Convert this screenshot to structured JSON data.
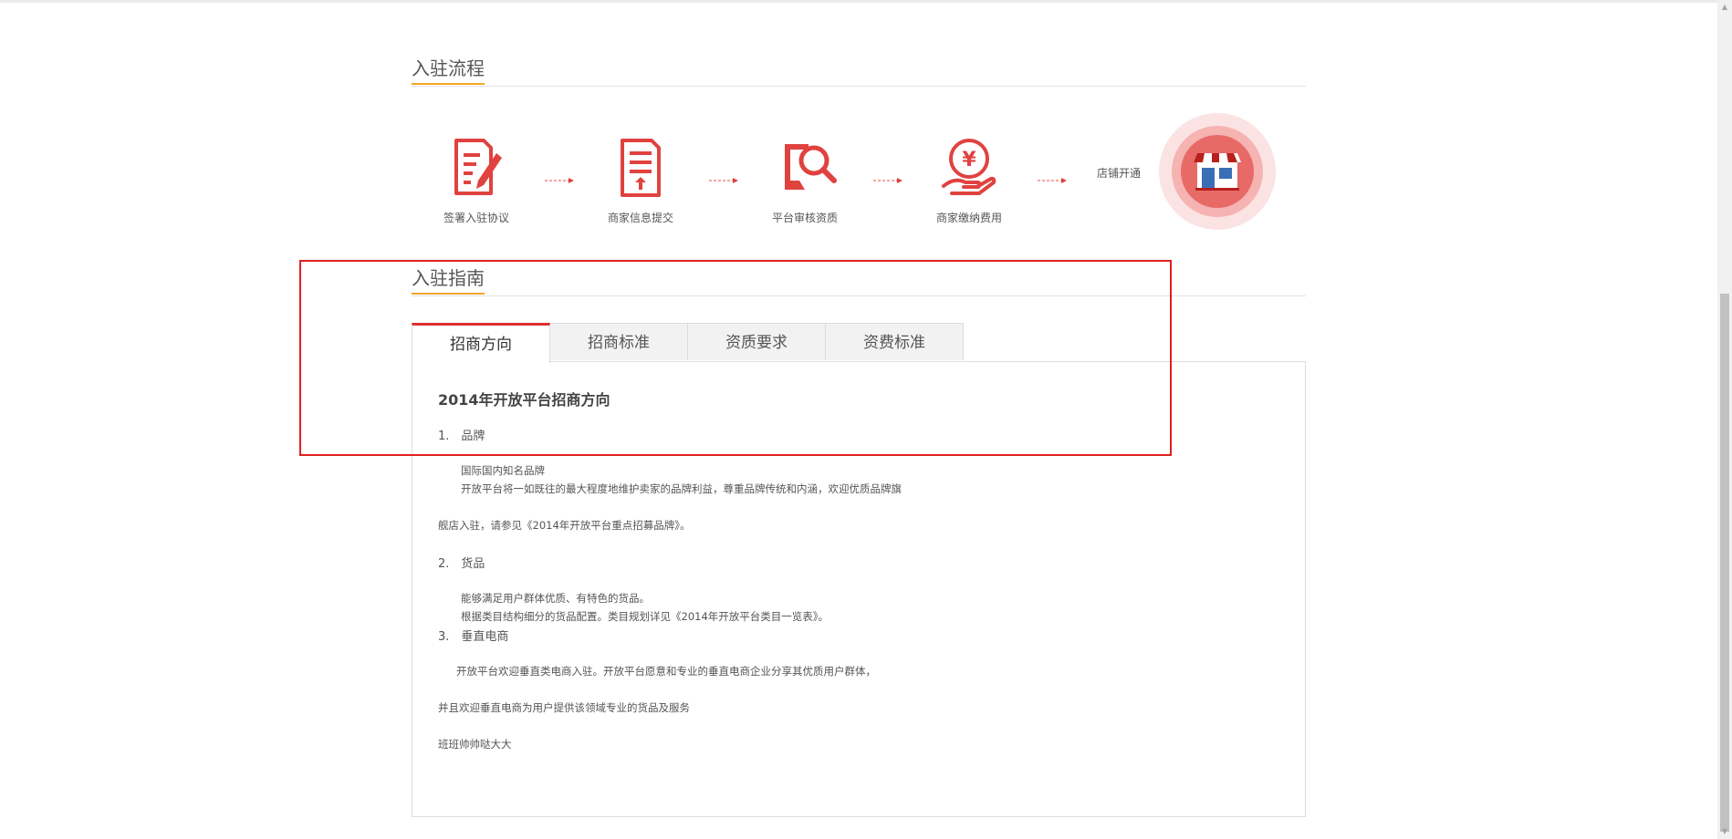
{
  "process": {
    "title": "入驻流程",
    "steps": [
      {
        "label": "签署入驻协议",
        "icon": "sign-contract-icon"
      },
      {
        "label": "商家信息提交",
        "icon": "upload-document-icon"
      },
      {
        "label": "平台审核资质",
        "icon": "review-search-icon"
      },
      {
        "label": "商家缴纳费用",
        "icon": "yuan-payment-icon"
      }
    ],
    "final_label": "店铺开通",
    "final_icon": "shop-store-icon"
  },
  "guide": {
    "title": "入驻指南",
    "tabs": [
      "招商方向",
      "招商标准",
      "资质要求",
      "资费标准"
    ],
    "active_tab": 0,
    "content": {
      "heading": "2014年开放平台招商方向",
      "item1_head": "1.　品牌",
      "item1_line1": "国际国内知名品牌",
      "item1_line2": "开放平台将一如既往的最大程度地维护卖家的品牌利益，尊重品牌传统和内涵，欢迎优质品牌旗",
      "item1_line3": "舰店入驻，请参见《2014年开放平台重点招募品牌》。",
      "item2_head": "2.　货品",
      "item2_line1": "能够满足用户群体优质、有特色的货品。",
      "item2_line2": "根据类目结构细分的货品配置。类目规划详见《2014年开放平台类目一览表》。",
      "item3_head": "3.　垂直电商",
      "item3_line1": "开放平台欢迎垂直类电商入驻。开放平台愿意和专业的垂直电商企业分享其优质用户群体，",
      "item3_line2": "并且欢迎垂直电商为用户提供该领域专业的货品及服务",
      "item3_line3": "班班帅帅哒大大"
    }
  },
  "colors": {
    "accent_red": "#e0423f",
    "tab_active_border": "#e02f2f",
    "underline_orange": "#f5a623",
    "highlight_box": "#e02020"
  }
}
